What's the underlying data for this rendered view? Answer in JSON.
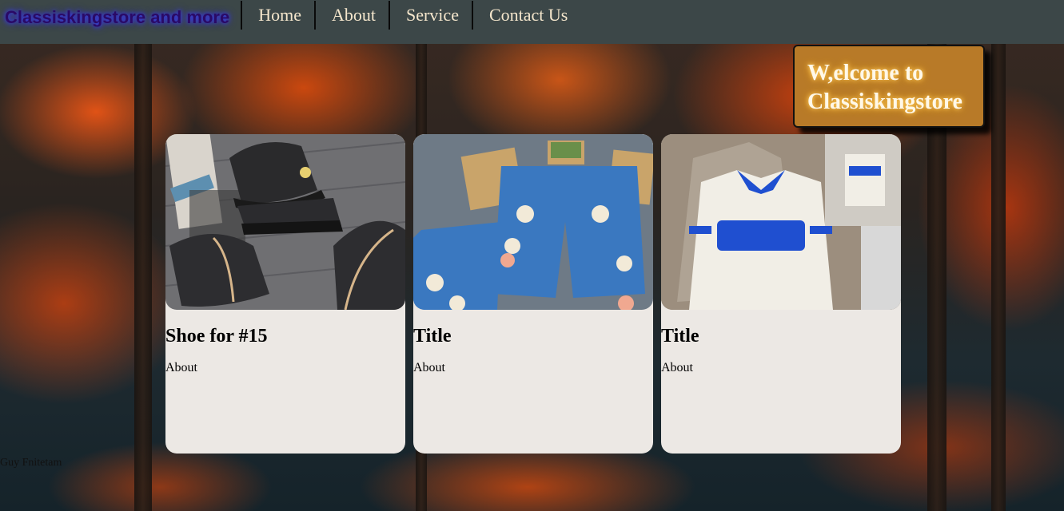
{
  "navbar": {
    "brand": "Classiskingstore and more",
    "links": [
      "Home",
      "About",
      "Service",
      "Contact Us"
    ]
  },
  "welcome": {
    "line1": "W,elcome to",
    "line2": "Classiskingstore"
  },
  "cards": [
    {
      "title": "Shoe for #15",
      "text": "About",
      "image": "black-sneakers-photo"
    },
    {
      "title": "Title",
      "text": "About",
      "image": "denim-skull-shorts-photo"
    },
    {
      "title": "Title",
      "text": "About",
      "image": "white-blue-polo-sweater-photo"
    }
  ],
  "footer": {
    "text": "Guy Fnitetam"
  },
  "colors": {
    "navbar_bg": "#3c4748",
    "nav_link": "#f4e6cc",
    "welcome_bg": "#b87a28",
    "card_bg": "#ece8e4"
  }
}
